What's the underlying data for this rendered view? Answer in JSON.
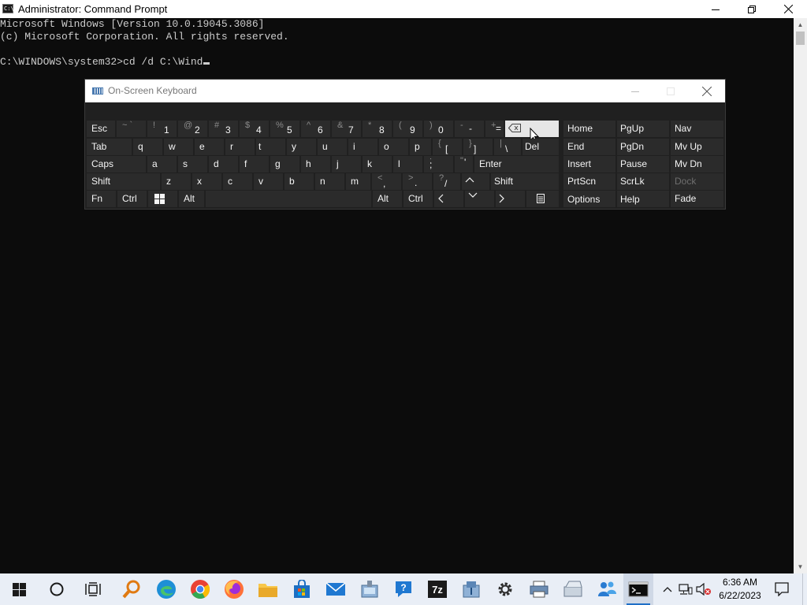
{
  "window": {
    "title": "Administrator: Command Prompt",
    "app_icon_text": "C:\\"
  },
  "console": {
    "lines": [
      "Microsoft Windows [Version 10.0.19045.3086]",
      "(c) Microsoft Corporation. All rights reserved.",
      "",
      "C:\\WINDOWS\\system32>cd /d C:\\Wind"
    ]
  },
  "osk": {
    "title": "On-Screen Keyboard",
    "rows": [
      [
        {
          "name": "esc",
          "label": "Esc"
        },
        {
          "name": "tilde",
          "shift": "~ `",
          "main": ""
        },
        {
          "name": "1",
          "shift": "!",
          "main": "1"
        },
        {
          "name": "2",
          "shift": "@",
          "main": "2"
        },
        {
          "name": "3",
          "shift": "#",
          "main": "3"
        },
        {
          "name": "4",
          "shift": "$",
          "main": "4"
        },
        {
          "name": "5",
          "shift": "%",
          "main": "5"
        },
        {
          "name": "6",
          "shift": "^",
          "main": "6"
        },
        {
          "name": "7",
          "shift": "&",
          "main": "7"
        },
        {
          "name": "8",
          "shift": "*",
          "main": "8"
        },
        {
          "name": "9",
          "shift": "(",
          "main": "9"
        },
        {
          "name": "0",
          "shift": ")",
          "main": "0"
        },
        {
          "name": "minus",
          "shift": "-",
          "main": "-"
        },
        {
          "name": "equals",
          "shift": "+",
          "main": "="
        },
        {
          "name": "backspace",
          "icon": "backspace-icon"
        }
      ],
      [
        {
          "name": "tab",
          "label": "Tab"
        },
        {
          "name": "q",
          "label": "q"
        },
        {
          "name": "w",
          "label": "w"
        },
        {
          "name": "e",
          "label": "e"
        },
        {
          "name": "r",
          "label": "r"
        },
        {
          "name": "t",
          "label": "t"
        },
        {
          "name": "y",
          "label": "y"
        },
        {
          "name": "u",
          "label": "u"
        },
        {
          "name": "i",
          "label": "i"
        },
        {
          "name": "o",
          "label": "o"
        },
        {
          "name": "p",
          "label": "p"
        },
        {
          "name": "lbracket",
          "shift": "{",
          "main": "["
        },
        {
          "name": "rbracket",
          "shift": "}",
          "main": "]"
        },
        {
          "name": "backslash",
          "shift": "|",
          "main": "\\"
        },
        {
          "name": "del",
          "label": "Del"
        }
      ],
      [
        {
          "name": "caps",
          "label": "Caps"
        },
        {
          "name": "a",
          "label": "a"
        },
        {
          "name": "s",
          "label": "s"
        },
        {
          "name": "d",
          "label": "d"
        },
        {
          "name": "f",
          "label": "f"
        },
        {
          "name": "g",
          "label": "g"
        },
        {
          "name": "h",
          "label": "h"
        },
        {
          "name": "j",
          "label": "j"
        },
        {
          "name": "k",
          "label": "k"
        },
        {
          "name": "l",
          "label": "l"
        },
        {
          "name": "semicolon",
          "shift": ":",
          "main": ";"
        },
        {
          "name": "quote",
          "shift": "\"",
          "main": "'"
        },
        {
          "name": "enter",
          "label": "Enter"
        }
      ],
      [
        {
          "name": "shift-left",
          "label": "Shift"
        },
        {
          "name": "z",
          "label": "z"
        },
        {
          "name": "x",
          "label": "x"
        },
        {
          "name": "c",
          "label": "c"
        },
        {
          "name": "v",
          "label": "v"
        },
        {
          "name": "b",
          "label": "b"
        },
        {
          "name": "n",
          "label": "n"
        },
        {
          "name": "m",
          "label": "m"
        },
        {
          "name": "comma",
          "shift": "<",
          "main": ","
        },
        {
          "name": "period",
          "shift": ">",
          "main": "."
        },
        {
          "name": "slash",
          "shift": "?",
          "main": "/"
        },
        {
          "name": "up",
          "icon": "chevron-up-icon"
        },
        {
          "name": "shift-right",
          "label": "Shift"
        }
      ],
      [
        {
          "name": "fn",
          "label": "Fn"
        },
        {
          "name": "ctrl-left",
          "label": "Ctrl"
        },
        {
          "name": "windows",
          "icon": "windows-icon"
        },
        {
          "name": "alt-left",
          "label": "Alt"
        },
        {
          "name": "space",
          "label": ""
        },
        {
          "name": "alt-right",
          "label": "Alt"
        },
        {
          "name": "ctrl-right",
          "label": "Ctrl"
        },
        {
          "name": "left",
          "icon": "chevron-left-icon"
        },
        {
          "name": "down",
          "icon": "chevron-down-icon"
        },
        {
          "name": "right",
          "icon": "chevron-right-icon"
        },
        {
          "name": "menu",
          "icon": "context-menu-icon"
        }
      ]
    ],
    "nav_keys": [
      [
        "Home",
        "PgUp",
        "Nav"
      ],
      [
        "End",
        "PgDn",
        "Mv Up"
      ],
      [
        "Insert",
        "Pause",
        "Mv Dn"
      ],
      [
        "PrtScn",
        "ScrLk",
        "Dock"
      ],
      [
        "Options",
        "Help",
        "Fade"
      ]
    ]
  },
  "taskbar": {
    "items": [
      {
        "name": "start-button",
        "icon": "windows-logo-icon"
      },
      {
        "name": "search-button",
        "icon": "cortana-circle-icon"
      },
      {
        "name": "task-view-button",
        "icon": "task-view-icon"
      },
      {
        "name": "search-everything-app",
        "icon": "magnifier-app-icon"
      },
      {
        "name": "edge-app",
        "icon": "edge-icon"
      },
      {
        "name": "chrome-app",
        "icon": "chrome-icon"
      },
      {
        "name": "firefox-app",
        "icon": "firefox-icon"
      },
      {
        "name": "file-explorer-app",
        "icon": "folder-icon"
      },
      {
        "name": "store-app",
        "icon": "store-icon"
      },
      {
        "name": "mail-app",
        "icon": "mail-icon"
      },
      {
        "name": "control-panel-app",
        "icon": "control-panel-icon"
      },
      {
        "name": "help-app",
        "icon": "help-icon"
      },
      {
        "name": "7zip-app",
        "icon": "7zip-icon"
      },
      {
        "name": "network-app",
        "icon": "network-app-icon"
      },
      {
        "name": "settings-app",
        "icon": "gear-icon"
      },
      {
        "name": "printer-app",
        "icon": "printer-icon"
      },
      {
        "name": "scanner-app",
        "icon": "scanner-icon"
      },
      {
        "name": "remote-app",
        "icon": "people-icon"
      },
      {
        "name": "cmd-app",
        "icon": "terminal-icon"
      }
    ],
    "tray": {
      "chevron": "chevron-up-icon",
      "network": "network-icon",
      "volume": "volume-muted-icon"
    },
    "seven_zip_label": "7z",
    "clock": {
      "time": "6:36 AM",
      "date": "6/22/2023"
    }
  },
  "colors": {
    "console_bg": "#0c0c0c",
    "console_text": "#cccccc",
    "osk_bg": "#202020",
    "osk_key": "#2b2b2b",
    "taskbar_bg": "#e9eef6",
    "accent": "#1f6fc7"
  }
}
